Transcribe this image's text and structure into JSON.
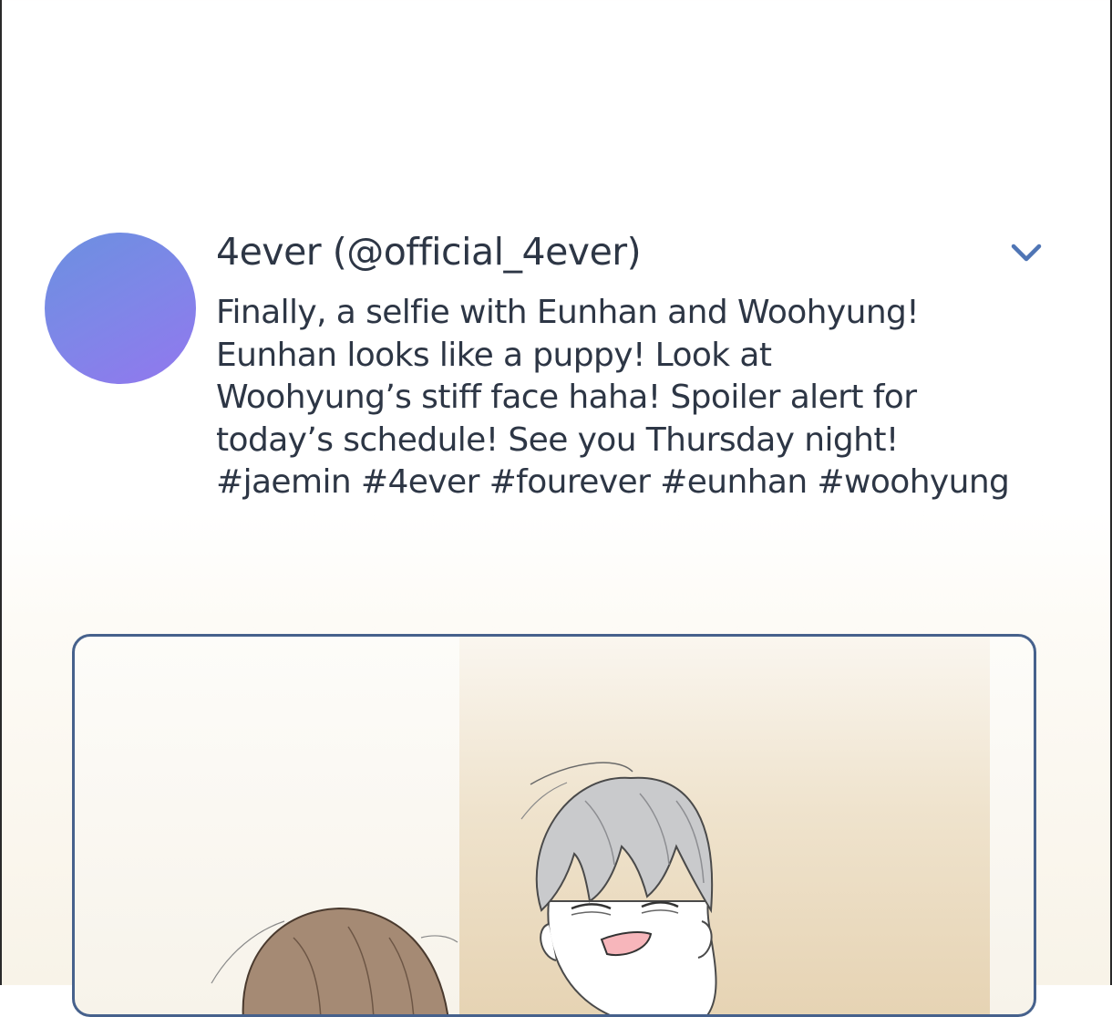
{
  "post": {
    "display_name": "4ever",
    "handle": "(@official_4ever)",
    "body_lines": [
      "Finally, a selfie with Eunhan and Woohyung!",
      "Eunhan looks like a puppy! Look at",
      "Woohyung’s stiff face haha! Spoiler alert for",
      "today’s schedule! See you Thursday night!",
      "#jaemin #4ever #fourever #eunhan #woohyung"
    ],
    "menu_icon": "chevron-down-icon",
    "avatar_colors": [
      "#6b90e0",
      "#9277ee"
    ]
  },
  "colors": {
    "text": "#2d3645",
    "card_border": "#46618c",
    "chevron": "#4f75b5"
  }
}
